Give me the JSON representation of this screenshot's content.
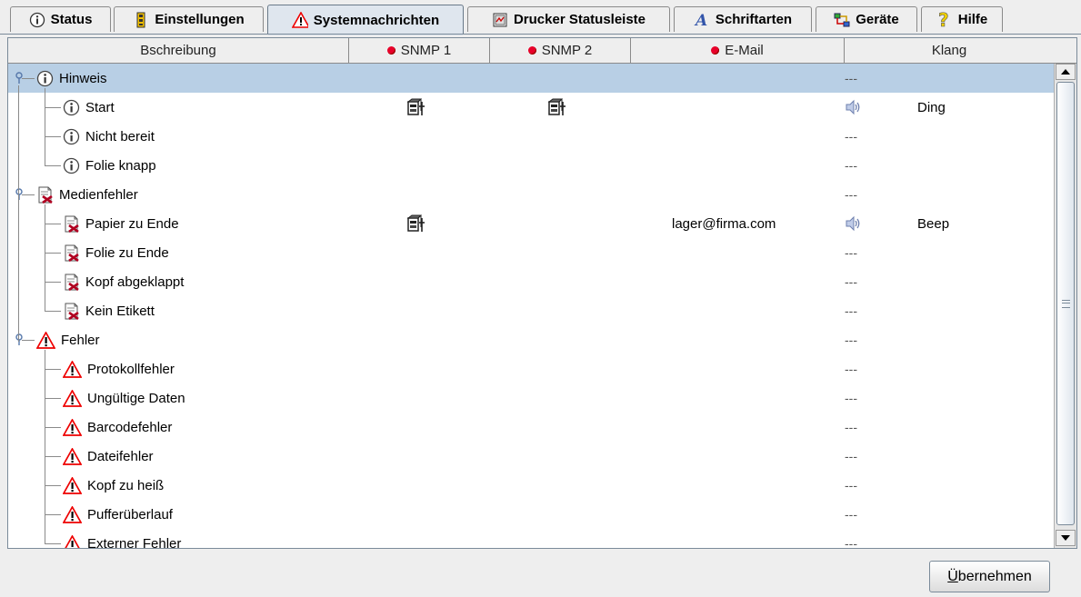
{
  "tabs": [
    {
      "label": "Status",
      "icon": "info-icon"
    },
    {
      "label": "Einstellungen",
      "icon": "settings-icon"
    },
    {
      "label": "Systemnachrichten",
      "icon": "warning-icon",
      "active": true
    },
    {
      "label": "Drucker Statusleiste",
      "icon": "printer-status-icon"
    },
    {
      "label": "Schriftarten",
      "icon": "font-icon"
    },
    {
      "label": "Geräte",
      "icon": "devices-icon"
    },
    {
      "label": "Hilfe",
      "icon": "help-icon"
    }
  ],
  "table": {
    "columns": {
      "description": "Bschreibung",
      "snmp1": "SNMP 1",
      "snmp2": "SNMP 2",
      "email": "E-Mail",
      "sound": "Klang"
    },
    "rows": [
      {
        "label": "Hinweis",
        "level": 0,
        "icon": "info",
        "email": "",
        "dash": "---",
        "sound_name": "",
        "selected": true
      },
      {
        "label": "Start",
        "level": 1,
        "icon": "info",
        "snmp1": true,
        "snmp2": true,
        "sound": true,
        "sound_name": "Ding"
      },
      {
        "label": "Nicht bereit",
        "level": 1,
        "icon": "info",
        "dash": "---"
      },
      {
        "label": "Folie knapp",
        "level": 1,
        "icon": "info",
        "dash": "---"
      },
      {
        "label": "Medienfehler",
        "level": 0,
        "icon": "media",
        "dash": "---"
      },
      {
        "label": "Papier zu Ende",
        "level": 1,
        "icon": "media",
        "snmp1": true,
        "email": "lager@firma.com",
        "sound": true,
        "sound_name": "Beep"
      },
      {
        "label": "Folie zu Ende",
        "level": 1,
        "icon": "media",
        "dash": "---"
      },
      {
        "label": "Kopf abgeklappt",
        "level": 1,
        "icon": "media",
        "dash": "---"
      },
      {
        "label": "Kein Etikett",
        "level": 1,
        "icon": "media",
        "dash": "---"
      },
      {
        "label": "Fehler",
        "level": 0,
        "icon": "warning",
        "dash": "---"
      },
      {
        "label": "Protokollfehler",
        "level": 1,
        "icon": "warning",
        "dash": "---"
      },
      {
        "label": "Ungültige Daten",
        "level": 1,
        "icon": "warning",
        "dash": "---"
      },
      {
        "label": "Barcodefehler",
        "level": 1,
        "icon": "warning",
        "dash": "---"
      },
      {
        "label": "Dateifehler",
        "level": 1,
        "icon": "warning",
        "dash": "---"
      },
      {
        "label": "Kopf zu heiß",
        "level": 1,
        "icon": "warning",
        "dash": "---"
      },
      {
        "label": "Pufferüberlauf",
        "level": 1,
        "icon": "warning",
        "dash": "---"
      },
      {
        "label": "Externer Fehler",
        "level": 1,
        "icon": "warning",
        "dash": "---"
      }
    ]
  },
  "apply_button": {
    "mnemonic": "Ü",
    "rest": "bernehmen"
  },
  "colors": {
    "selection": "#b8cfe5",
    "accent_red": "#e8002a",
    "border": "#7a8a99"
  }
}
